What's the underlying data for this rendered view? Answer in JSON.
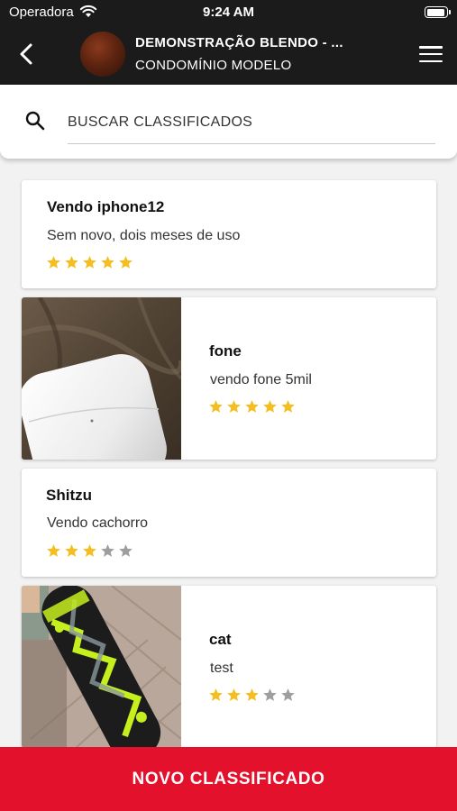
{
  "status_bar": {
    "carrier": "Operadora",
    "time": "9:24 AM"
  },
  "header": {
    "title": "DEMONSTRAÇÃO BLENDO - ...",
    "subtitle": "CONDOMÍNIO MODELO"
  },
  "search": {
    "placeholder": "BUSCAR CLASSIFICADOS"
  },
  "listings": [
    {
      "title": "Vendo iphone12",
      "description": "Sem novo, dois meses de uso",
      "rating": 5,
      "image": null
    },
    {
      "title": "fone",
      "description": "vendo fone 5mil",
      "rating": 5,
      "image": "earbuds-case-photo"
    },
    {
      "title": "Shitzu",
      "description": "Vendo cachorro",
      "rating": 3,
      "image": null
    },
    {
      "title": "cat",
      "description": "test",
      "rating": 3,
      "image": "skateboard-photo"
    }
  ],
  "rating_max": 5,
  "colors": {
    "accent": "#e3112c",
    "header_bg": "#1b1b1b",
    "star_filled": "#f5bd1f",
    "star_empty": "#9e9e9e"
  },
  "footer": {
    "new_button_label": "NOVO CLASSIFICADO"
  }
}
